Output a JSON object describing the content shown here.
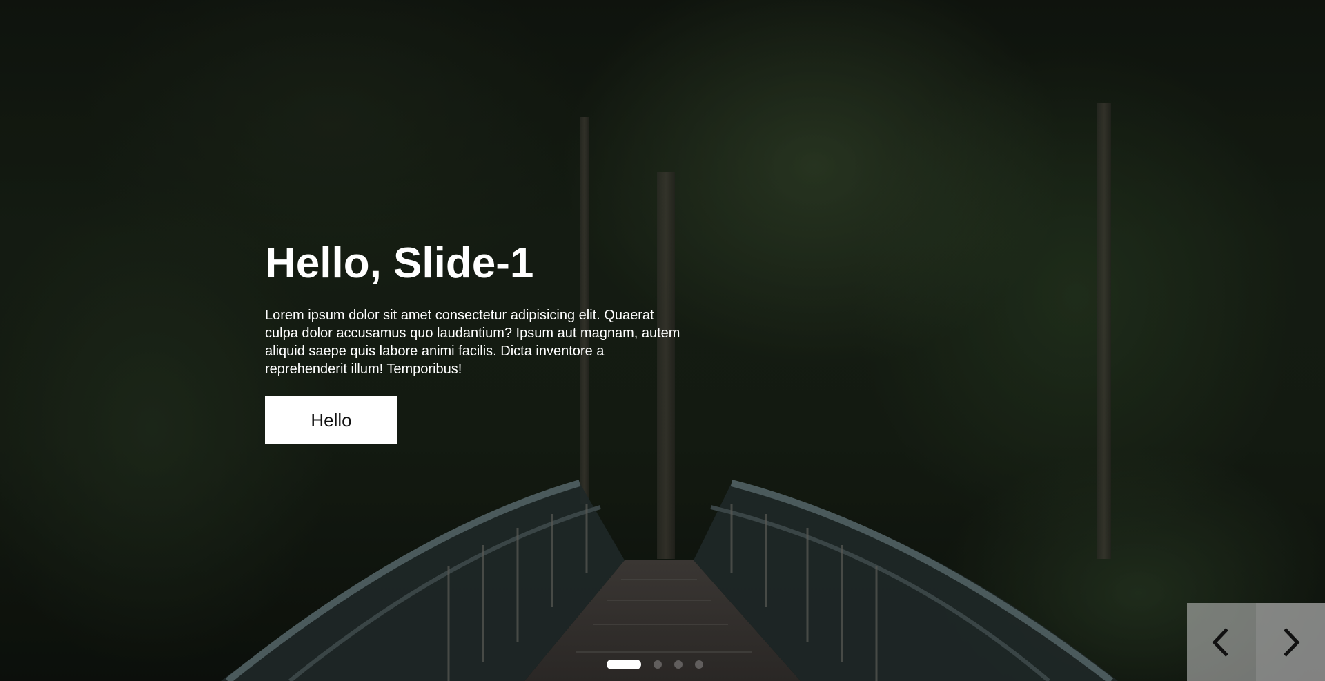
{
  "slide": {
    "title": "Hello, Slide-1",
    "text": "Lorem ipsum dolor sit amet consectetur adipisicing elit. Quaerat culpa dolor accusamus quo laudantium? Ipsum aut magnam, autem aliquid saepe quis labore animi facilis. Dicta inventore a reprehenderit illum! Temporibus!",
    "button_label": "Hello"
  },
  "navigation": {
    "prev_icon": "chevron-left-icon",
    "next_icon": "chevron-right-icon"
  },
  "pagination": {
    "count": 4,
    "active_index": 0
  },
  "colors": {
    "overlay_text": "#ffffff",
    "button_bg": "#ffffff",
    "button_text": "#111111"
  }
}
